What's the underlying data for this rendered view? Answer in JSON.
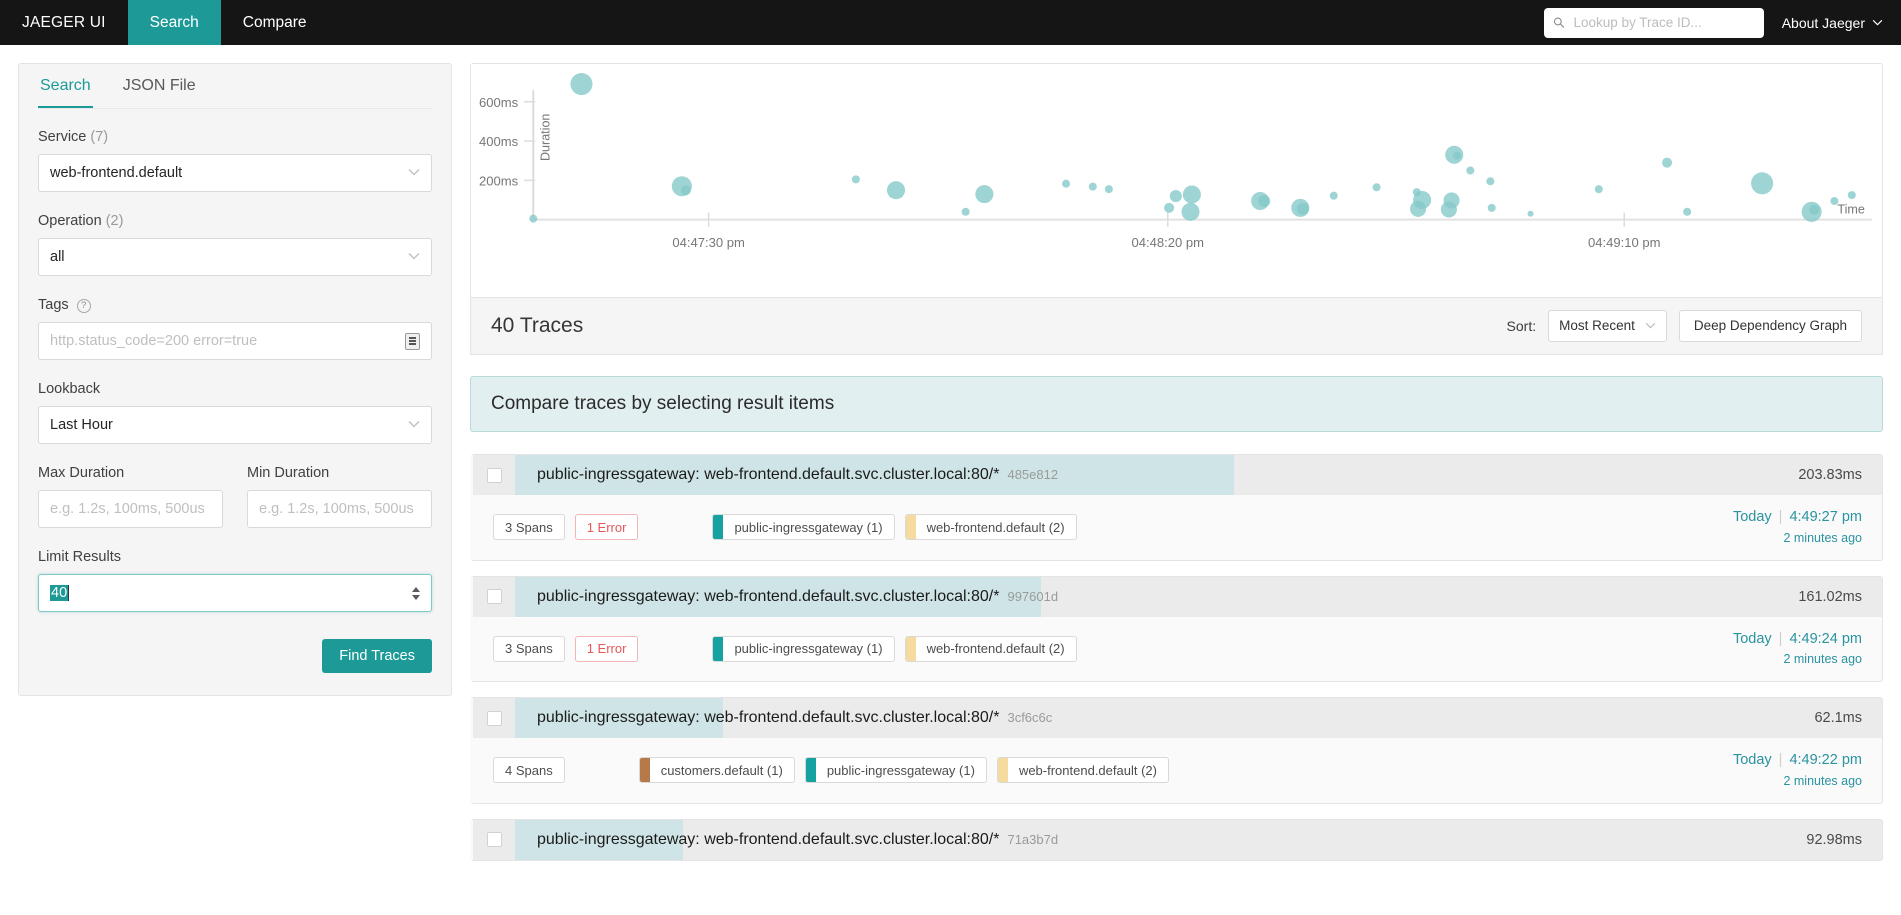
{
  "topnav": {
    "brand": "JAEGER UI",
    "items": [
      {
        "label": "Search",
        "active": true
      },
      {
        "label": "Compare",
        "active": false
      }
    ],
    "search_placeholder": "Lookup by Trace ID...",
    "about_label": "About Jaeger"
  },
  "sidebar": {
    "tabs": [
      {
        "label": "Search",
        "active": true
      },
      {
        "label": "JSON File",
        "active": false
      }
    ],
    "service": {
      "label": "Service",
      "count": "(7)",
      "value": "web-frontend.default"
    },
    "operation": {
      "label": "Operation",
      "count": "(2)",
      "value": "all"
    },
    "tags": {
      "label": "Tags",
      "placeholder": "http.status_code=200 error=true"
    },
    "lookback": {
      "label": "Lookback",
      "value": "Last Hour"
    },
    "max_duration": {
      "label": "Max Duration",
      "placeholder": "e.g. 1.2s, 100ms, 500us"
    },
    "min_duration": {
      "label": "Min Duration",
      "placeholder": "e.g. 1.2s, 100ms, 500us"
    },
    "limit_results": {
      "label": "Limit Results",
      "value": "40"
    },
    "find_traces_label": "Find Traces"
  },
  "results_header": {
    "title": "40 Traces",
    "sort_label": "Sort:",
    "sort_value": "Most Recent",
    "ddg_label": "Deep Dependency Graph"
  },
  "compare_banner": {
    "text": "Compare traces by selecting result items"
  },
  "chart_data": {
    "type": "scatter",
    "title": "",
    "xlabel": "Time",
    "ylabel": "Duration",
    "grid": false,
    "legend": "none",
    "xticks": [
      "04:47:30 pm",
      "04:48:20 pm",
      "04:49:10 pm"
    ],
    "yticks": [
      "200ms",
      "400ms",
      "600ms"
    ],
    "ylim": [
      0,
      700
    ],
    "point_color": "#84c8c8",
    "points": [
      {
        "x": 0.036,
        "y": 690,
        "r": 11
      },
      {
        "x": 0.0,
        "y": 5,
        "r": 4
      },
      {
        "x": 0.111,
        "y": 170,
        "r": 10
      },
      {
        "x": 0.114,
        "y": 150,
        "r": 5
      },
      {
        "x": 0.241,
        "y": 205,
        "r": 4
      },
      {
        "x": 0.271,
        "y": 150,
        "r": 9
      },
      {
        "x": 0.337,
        "y": 130,
        "r": 9
      },
      {
        "x": 0.323,
        "y": 40,
        "r": 4
      },
      {
        "x": 0.398,
        "y": 183,
        "r": 4
      },
      {
        "x": 0.418,
        "y": 168,
        "r": 4
      },
      {
        "x": 0.43,
        "y": 155,
        "r": 4
      },
      {
        "x": 0.48,
        "y": 120,
        "r": 6
      },
      {
        "x": 0.475,
        "y": 60,
        "r": 5
      },
      {
        "x": 0.492,
        "y": 128,
        "r": 9
      },
      {
        "x": 0.491,
        "y": 40,
        "r": 9
      },
      {
        "x": 0.543,
        "y": 95,
        "r": 9
      },
      {
        "x": 0.546,
        "y": 95,
        "r": 6
      },
      {
        "x": 0.573,
        "y": 60,
        "r": 9
      },
      {
        "x": 0.575,
        "y": 55,
        "r": 6
      },
      {
        "x": 0.598,
        "y": 122,
        "r": 4
      },
      {
        "x": 0.63,
        "y": 165,
        "r": 4
      },
      {
        "x": 0.66,
        "y": 140,
        "r": 4
      },
      {
        "x": 0.664,
        "y": 100,
        "r": 9
      },
      {
        "x": 0.661,
        "y": 55,
        "r": 8
      },
      {
        "x": 0.686,
        "y": 98,
        "r": 8
      },
      {
        "x": 0.684,
        "y": 52,
        "r": 8
      },
      {
        "x": 0.688,
        "y": 330,
        "r": 9
      },
      {
        "x": 0.69,
        "y": 325,
        "r": 4
      },
      {
        "x": 0.7,
        "y": 250,
        "r": 4
      },
      {
        "x": 0.715,
        "y": 195,
        "r": 4
      },
      {
        "x": 0.716,
        "y": 60,
        "r": 4
      },
      {
        "x": 0.745,
        "y": 30,
        "r": 3
      },
      {
        "x": 0.796,
        "y": 155,
        "r": 4
      },
      {
        "x": 0.847,
        "y": 290,
        "r": 5
      },
      {
        "x": 0.862,
        "y": 40,
        "r": 4
      },
      {
        "x": 0.918,
        "y": 185,
        "r": 11
      },
      {
        "x": 0.955,
        "y": 40,
        "r": 10
      },
      {
        "x": 0.957,
        "y": 50,
        "r": 5
      },
      {
        "x": 0.972,
        "y": 95,
        "r": 4
      },
      {
        "x": 0.985,
        "y": 125,
        "r": 4
      }
    ]
  },
  "traces": [
    {
      "name": "public-ingressgateway: web-frontend.default.svc.cluster.local:80/*",
      "id": "485e812",
      "duration": "203.83ms",
      "bar_pct": 56,
      "spans": "3 Spans",
      "error": "1 Error",
      "services": [
        {
          "label": "public-ingressgateway (1)",
          "color": "#17a2a2"
        },
        {
          "label": "web-frontend.default (2)",
          "color": "#f5dba0"
        }
      ],
      "day": "Today",
      "time": "4:49:27 pm",
      "ago": "2 minutes ago"
    },
    {
      "name": "public-ingressgateway: web-frontend.default.svc.cluster.local:80/*",
      "id": "997601d",
      "duration": "161.02ms",
      "bar_pct": 41,
      "spans": "3 Spans",
      "error": "1 Error",
      "services": [
        {
          "label": "public-ingressgateway (1)",
          "color": "#17a2a2"
        },
        {
          "label": "web-frontend.default (2)",
          "color": "#f5dba0"
        }
      ],
      "day": "Today",
      "time": "4:49:24 pm",
      "ago": "2 minutes ago"
    },
    {
      "name": "public-ingressgateway: web-frontend.default.svc.cluster.local:80/*",
      "id": "3cf6c6c",
      "duration": "62.1ms",
      "bar_pct": 16,
      "spans": "4 Spans",
      "error": "",
      "services": [
        {
          "label": "customers.default (1)",
          "color": "#b5794a"
        },
        {
          "label": "public-ingressgateway (1)",
          "color": "#17a2a2"
        },
        {
          "label": "web-frontend.default (2)",
          "color": "#f5dba0"
        }
      ],
      "day": "Today",
      "time": "4:49:22 pm",
      "ago": "2 minutes ago"
    },
    {
      "name": "public-ingressgateway: web-frontend.default.svc.cluster.local:80/*",
      "id": "71a3b7d",
      "duration": "92.98ms",
      "bar_pct": 13,
      "spans": "",
      "error": "",
      "services": [],
      "day": "",
      "time": "",
      "ago": ""
    }
  ]
}
